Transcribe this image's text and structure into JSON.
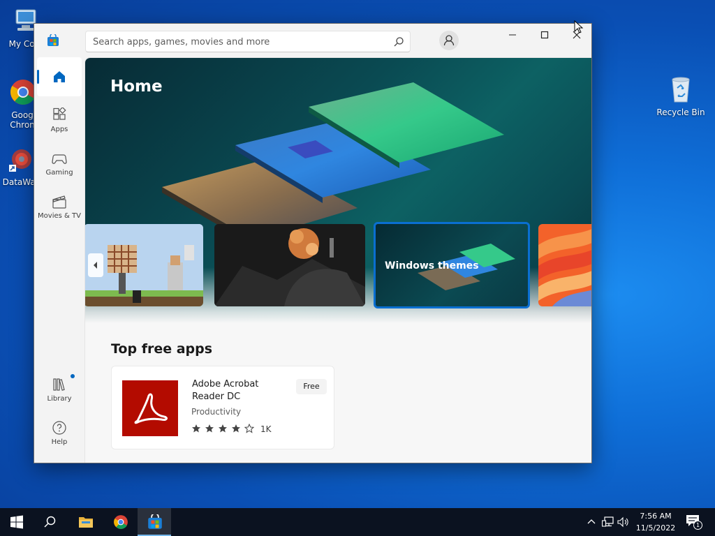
{
  "desktop": {
    "icons": [
      {
        "name": "my-computer",
        "label": "My Com"
      },
      {
        "name": "google-chrome",
        "label": "Goog Chron"
      },
      {
        "name": "datawag",
        "label": "DataWag"
      },
      {
        "name": "recycle-bin",
        "label": "Recycle Bin"
      }
    ]
  },
  "store": {
    "search": {
      "placeholder": "Search apps, games, movies and more"
    },
    "nav": {
      "home": "",
      "apps": "Apps",
      "gaming": "Gaming",
      "movies": "Movies & TV",
      "library": "Library",
      "help": "Help"
    },
    "hero": {
      "title": "Home",
      "cards": [
        {
          "title": ""
        },
        {
          "title": ""
        },
        {
          "title": "Windows themes"
        },
        {
          "title": ""
        }
      ]
    },
    "top_free": {
      "section_title": "Top free apps",
      "apps": [
        {
          "name": "Adobe Acrobat Reader DC",
          "category": "Productivity",
          "rating_stars": 4,
          "rating_max": 5,
          "rating_count": "1K",
          "price": "Free"
        }
      ]
    }
  },
  "taskbar": {
    "clock": {
      "time": "7:56 AM",
      "date": "11/5/2022"
    },
    "notification_count": "1"
  },
  "colors": {
    "accent": "#0067c0",
    "acrobat_red": "#b30b00",
    "taskbar": "#0b1220"
  }
}
